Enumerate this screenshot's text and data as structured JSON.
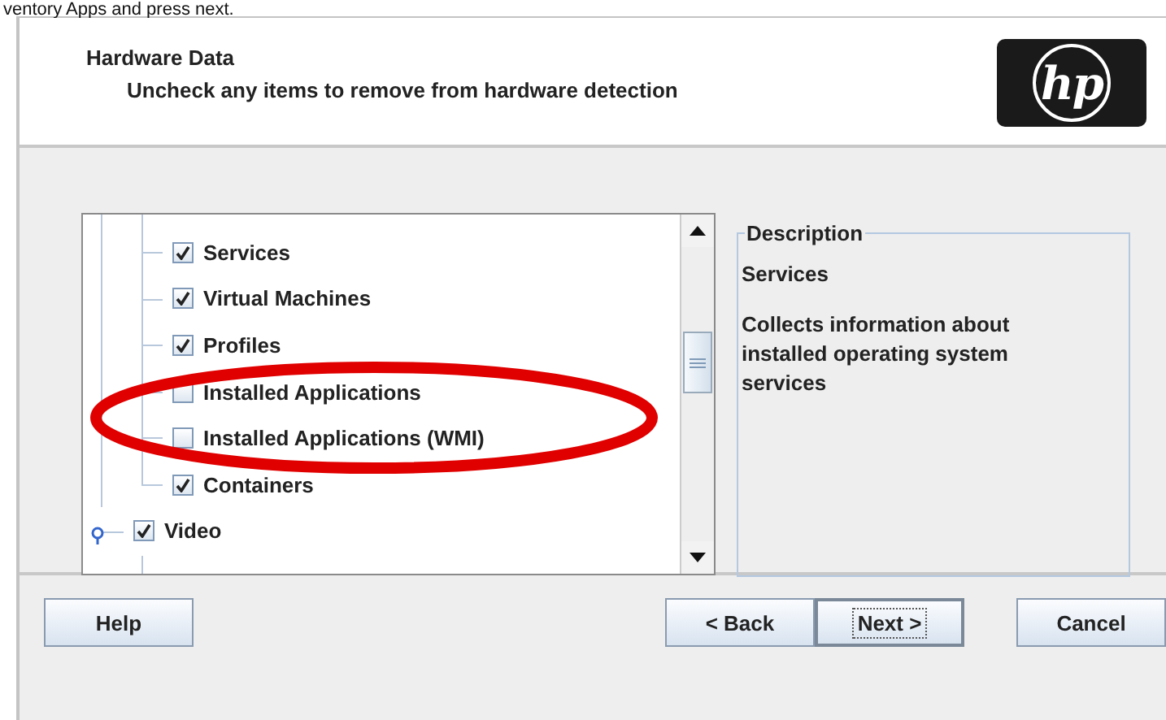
{
  "caption": "ventory Apps and press next.",
  "header": {
    "title": "Hardware Data",
    "subtitle": "Uncheck any items to remove from hardware detection",
    "logo_text": "hp"
  },
  "tree": {
    "items": [
      {
        "children": [
          {
            "label": "Services",
            "checked": true
          },
          {
            "label": "Virtual Machines",
            "checked": true
          },
          {
            "label": "Profiles",
            "checked": true
          },
          {
            "label": "Installed Applications",
            "checked": false
          },
          {
            "label": "Installed Applications (WMI)",
            "checked": false
          },
          {
            "label": "Containers",
            "checked": true
          }
        ]
      },
      {
        "label": "Video",
        "checked": true,
        "expanded": true
      }
    ]
  },
  "description": {
    "legend": "Description",
    "title": "Services",
    "text": "Collects information about installed operating system services"
  },
  "buttons": [
    {
      "label": "Help",
      "kind": "help",
      "default": false
    },
    {
      "label": "< Back",
      "kind": "nav",
      "default": false
    },
    {
      "label": "Next >",
      "kind": "nav",
      "default": true
    },
    {
      "label": "Cancel",
      "kind": "cancel",
      "default": false
    }
  ]
}
